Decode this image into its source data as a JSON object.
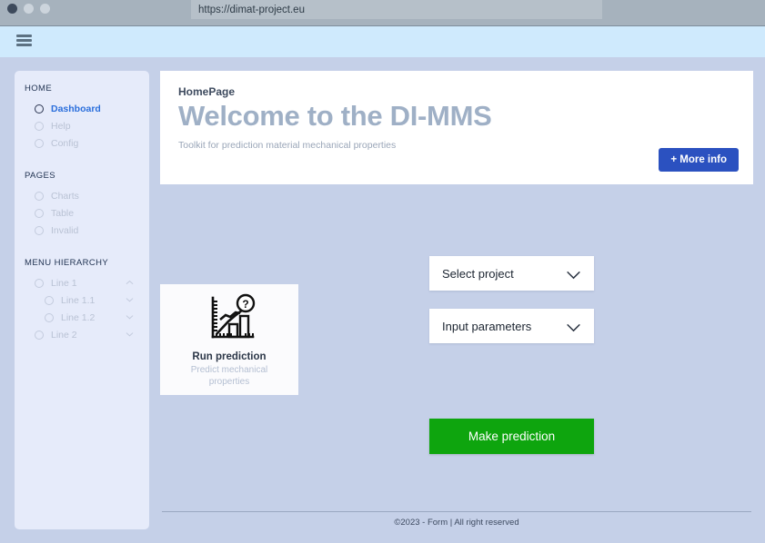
{
  "browser": {
    "url": "https://dimat-project.eu",
    "traffic_lights": [
      "close",
      "minimize",
      "maximize"
    ]
  },
  "topbar": {
    "menu_icon": "hamburger-icon"
  },
  "sidebar": {
    "groups": [
      {
        "title": "HOME",
        "items": [
          {
            "label": "Dashboard",
            "active": true,
            "chevron": null
          },
          {
            "label": "Help",
            "active": false,
            "chevron": null
          },
          {
            "label": "Config",
            "active": false,
            "chevron": null
          }
        ]
      },
      {
        "title": "PAGES",
        "items": [
          {
            "label": "Charts",
            "active": false,
            "chevron": null
          },
          {
            "label": "Table",
            "active": false,
            "chevron": null
          },
          {
            "label": "Invalid",
            "active": false,
            "chevron": null
          }
        ]
      },
      {
        "title": "MENU HIERARCHY",
        "items": [
          {
            "label": "Line 1",
            "active": false,
            "chevron": "up",
            "sub": false
          },
          {
            "label": "Line 1.1",
            "active": false,
            "chevron": "down",
            "sub": true
          },
          {
            "label": "Line 1.2",
            "active": false,
            "chevron": "down",
            "sub": true
          },
          {
            "label": "Line 2",
            "active": false,
            "chevron": "down",
            "sub": false
          }
        ]
      }
    ]
  },
  "hero": {
    "eyebrow": "HomePage",
    "title": "Welcome to the DI-MMS",
    "subtitle": "Toolkit for prediction material mechanical properties",
    "button_label": "+ More info"
  },
  "prediction_card": {
    "icon": "chart-question-icon",
    "title": "Run prediction",
    "subtitle": "Predict mechanical properties"
  },
  "controls": {
    "select_project": "Select project",
    "input_parameters": "Input parameters",
    "cta_label": "Make prediction"
  },
  "footer": {
    "text": "©2023 - Form  |   All right reserved"
  },
  "colors": {
    "page_background": "#c5d0e8",
    "sidebar_background": "#e6ebfa",
    "topbar": "#cfeafd",
    "browser_chrome": "#a6b2bd",
    "accent_blue": "#2b51c0",
    "active_nav_blue": "#2b6fdc",
    "cta_green": "#0ea50e",
    "hero_title_gray": "#9fb0c6"
  }
}
